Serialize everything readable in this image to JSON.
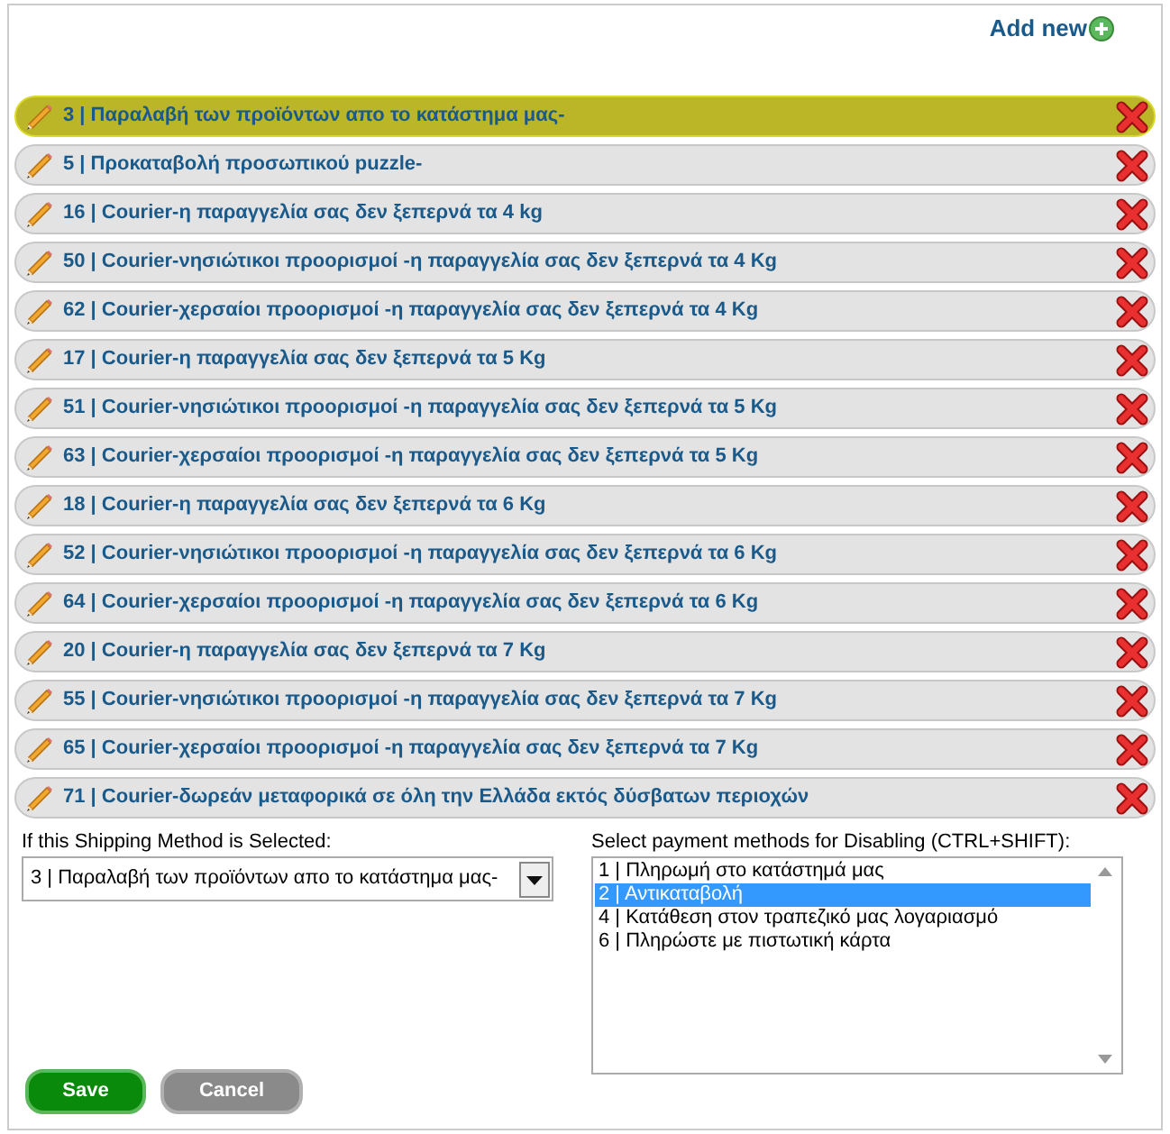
{
  "add_new": {
    "label": "Add new"
  },
  "methods": [
    {
      "label": "3 | Παραλαβή των προϊόντων απο το κατάστημα μας-",
      "selected": true
    },
    {
      "label": "5 | Προκαταβολή προσωπικού puzzle-",
      "selected": false
    },
    {
      "label": "16 | Courier-η παραγγελία σας δεν ξεπερνά τα 4 kg",
      "selected": false
    },
    {
      "label": "50 | Courier-νησιώτικοι προορισμοί -η παραγγελία σας δεν ξεπερνά τα 4 Kg",
      "selected": false
    },
    {
      "label": "62 | Courier-χερσαίοι προορισμοί -η παραγγελία σας δεν ξεπερνά τα 4 Kg",
      "selected": false
    },
    {
      "label": "17 | Courier-η παραγγελία σας δεν ξεπερνά τα 5 Kg",
      "selected": false
    },
    {
      "label": "51 | Courier-νησιώτικοι προορισμοί -η παραγγελία σας δεν ξεπερνά τα 5 Kg",
      "selected": false
    },
    {
      "label": "63 | Courier-χερσαίοι προορισμοί -η παραγγελία σας δεν ξεπερνά τα 5 Kg",
      "selected": false
    },
    {
      "label": "18 | Courier-η παραγγελία σας δεν ξεπερνά τα 6 Kg",
      "selected": false
    },
    {
      "label": "52 | Courier-νησιώτικοι προορισμοί -η παραγγελία σας δεν ξεπερνά τα 6 Kg",
      "selected": false
    },
    {
      "label": "64 | Courier-χερσαίοι προορισμοί -η παραγγελία σας δεν ξεπερνά τα 6 Kg",
      "selected": false
    },
    {
      "label": "20 | Courier-η παραγγελία σας δεν ξεπερνά τα 7 Kg",
      "selected": false
    },
    {
      "label": "55 | Courier-νησιώτικοι προορισμοί -η παραγγελία σας δεν ξεπερνά τα 7 Kg",
      "selected": false
    },
    {
      "label": "65 | Courier-χερσαίοι προορισμοί -η παραγγελία σας δεν ξεπερνά τα 7 Kg",
      "selected": false
    },
    {
      "label": "71 | Courier-δωρεάν μεταφορικά σε όλη την Ελλάδα εκτός δύσβατων περιοχών",
      "selected": false
    }
  ],
  "shipping_select": {
    "label": "If this Shipping Method is Selected:",
    "value": "3 | Παραλαβή των προϊόντων απο το κατάστημα μας-"
  },
  "payment_list": {
    "label": "Select payment methods for Disabling (CTRL+SHIFT):",
    "options": [
      {
        "label": "1 | Πληρωμή στο κατάστημά μας",
        "selected": false
      },
      {
        "label": "2 | Αντικαταβολή",
        "selected": true
      },
      {
        "label": "4 | Κατάθεση στον τραπεζικό μας λογαριασμό",
        "selected": false
      },
      {
        "label": "6 | Πληρώστε με πιστωτική κάρτα",
        "selected": false
      }
    ]
  },
  "buttons": [
    {
      "label": "Save",
      "kind": "primary"
    },
    {
      "label": "Cancel",
      "kind": "secondary"
    }
  ]
}
